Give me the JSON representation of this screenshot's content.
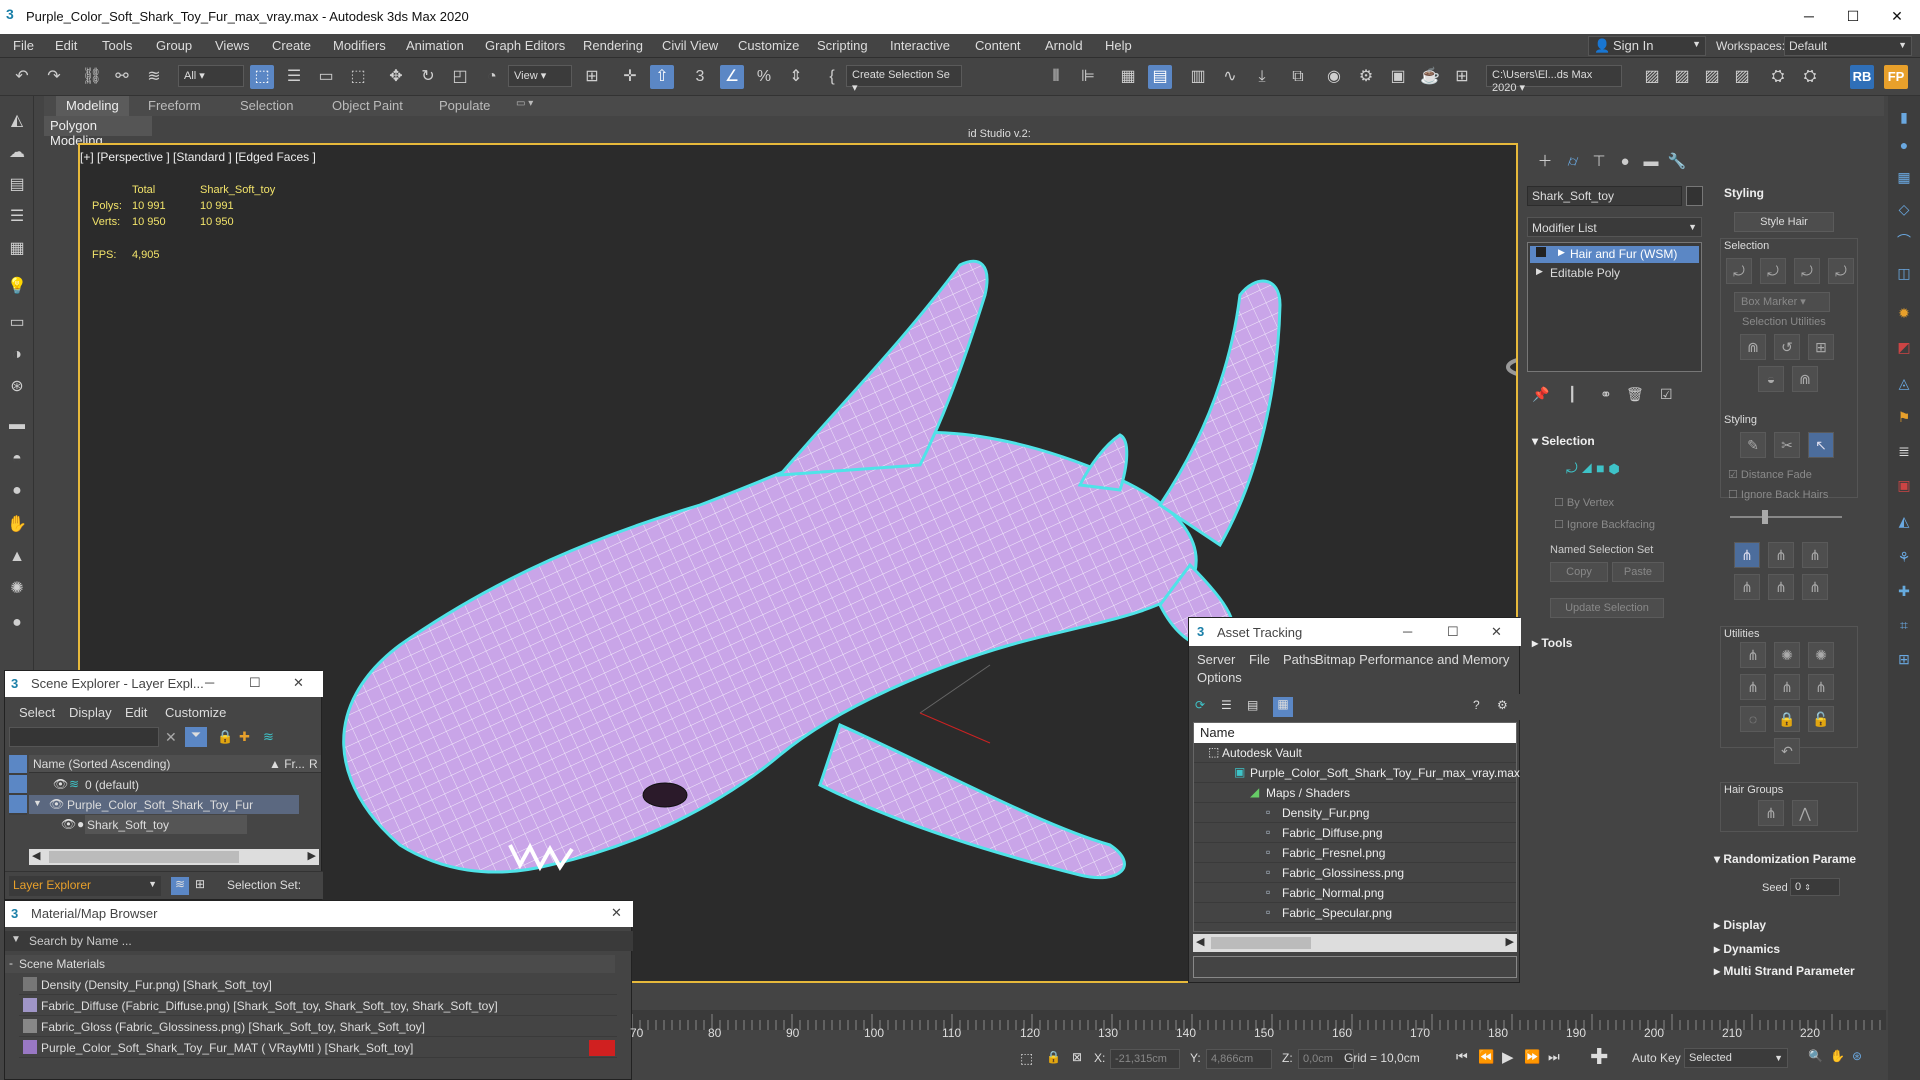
{
  "window": {
    "title": "Purple_Color_Soft_Shark_Toy_Fur_max_vray.max - Autodesk 3ds Max 2020",
    "minimize": "─",
    "maximize": "☐",
    "close": "✕"
  },
  "menubar": {
    "items": [
      "File",
      "Edit",
      "Tools",
      "Group",
      "Views",
      "Create",
      "Modifiers",
      "Animation",
      "Graph Editors",
      "Rendering",
      "Civil View",
      "Customize",
      "Scripting",
      "Interactive",
      "Content",
      "Arnold",
      "Help"
    ],
    "signin": "Sign In",
    "workspaces_label": "Workspaces:",
    "workspaces_value": "Default"
  },
  "toolbar": {
    "filter_value": "All",
    "refcoord_value": "View",
    "selection_set_value": "Create Selection Se",
    "studio_label": "id Studio v.2:",
    "project_path": "C:\\Users\\El...ds Max 2020"
  },
  "ribbon": {
    "tabs": [
      "Modeling",
      "Freeform",
      "Selection",
      "Object Paint",
      "Populate"
    ],
    "subtab": "Polygon Modeling"
  },
  "viewport": {
    "label": "[+] [Perspective ] [Standard ] [Edged Faces ]",
    "stats_total_header": "Total",
    "stats_obj_header": "Shark_Soft_toy",
    "polys_label": "Polys:",
    "polys_total": "10 991",
    "polys_obj": "10 991",
    "verts_label": "Verts:",
    "verts_total": "10 950",
    "verts_obj": "10 950",
    "fps_label": "FPS:",
    "fps_value": "4,905",
    "mesh_color": "#c9a5e8",
    "outline_color": "#4fe3e8"
  },
  "command_panel": {
    "object_name": "Shark_Soft_toy",
    "modifier_list": "Modifier List",
    "stack": [
      "Hair and Fur (WSM)",
      "Editable Poly"
    ],
    "selection_header": "Selection",
    "by_vertex": "By Vertex",
    "ignore_backfacing": "Ignore Backfacing",
    "named_selection_set": "Named Selection Set",
    "copy": "Copy",
    "paste": "Paste",
    "update_selection": "Update Selection",
    "tools_header": "Tools"
  },
  "styling_panel": {
    "header": "Styling",
    "style_hair": "Style Hair",
    "selection": "Selection",
    "box_marker": "Box Marker",
    "selection_utilities": "Selection Utilities",
    "styling": "Styling",
    "distance_fade": "Distance Fade",
    "ignore_back_hairs": "Ignore Back Hairs",
    "utilities": "Utilities",
    "hair_groups": "Hair Groups",
    "randomization": "Randomization Parame",
    "seed_label": "Seed",
    "seed_value": "0",
    "display": "Display",
    "dynamics": "Dynamics",
    "multi_strand": "Multi Strand Parameter"
  },
  "scene_explorer": {
    "title": "Scene Explorer - Layer Expl...",
    "menus": [
      "Select",
      "Display",
      "Edit",
      "Customize"
    ],
    "col_name": "Name (Sorted Ascending)",
    "col_fr": "▲ Fr...",
    "col_r": "R",
    "rows": [
      "0 (default)",
      "Purple_Color_Soft_Shark_Toy_Fur",
      "Shark_Soft_toy"
    ],
    "layer_explorer": "Layer Explorer",
    "selection_set": "Selection Set:"
  },
  "material_browser": {
    "title": "Material/Map Browser",
    "search": "Search by Name ...",
    "section": "Scene Materials",
    "rows": [
      "Density (Density_Fur.png) [Shark_Soft_toy]",
      "Fabric_Diffuse (Fabric_Diffuse.png) [Shark_Soft_toy, Shark_Soft_toy, Shark_Soft_toy]",
      "Fabric_Gloss (Fabric_Glossiness.png) [Shark_Soft_toy, Shark_Soft_toy]",
      "Purple_Color_Soft_Shark_Toy_Fur_MAT  ( VRayMtl ) [Shark_Soft_toy]"
    ]
  },
  "asset_tracking": {
    "title": "Asset Tracking",
    "menus": [
      "Server",
      "File",
      "Paths",
      "Bitmap Performance and Memory"
    ],
    "options": "Options",
    "col_name": "Name",
    "vault": "Autodesk Vault",
    "file": "Purple_Color_Soft_Shark_Toy_Fur_max_vray.max",
    "maps": "Maps / Shaders",
    "maps_files": [
      "Density_Fur.png",
      "Fabric_Diffuse.png",
      "Fabric_Fresnel.png",
      "Fabric_Glossiness.png",
      "Fabric_Normal.png",
      "Fabric_Specular.png"
    ]
  },
  "timeline": {
    "ticks": [
      "70",
      "80",
      "90",
      "100",
      "110",
      "120",
      "130",
      "140",
      "150",
      "160",
      "170",
      "180",
      "190",
      "200",
      "210",
      "220"
    ]
  },
  "statusbar": {
    "x_label": "X:",
    "x_value": "-21,315cm",
    "y_label": "Y:",
    "y_value": "4,866cm",
    "z_label": "Z:",
    "z_value": "0,0cm",
    "grid": "Grid = 10,0cm",
    "auto_key": "Auto Key",
    "selected": "Selected"
  }
}
